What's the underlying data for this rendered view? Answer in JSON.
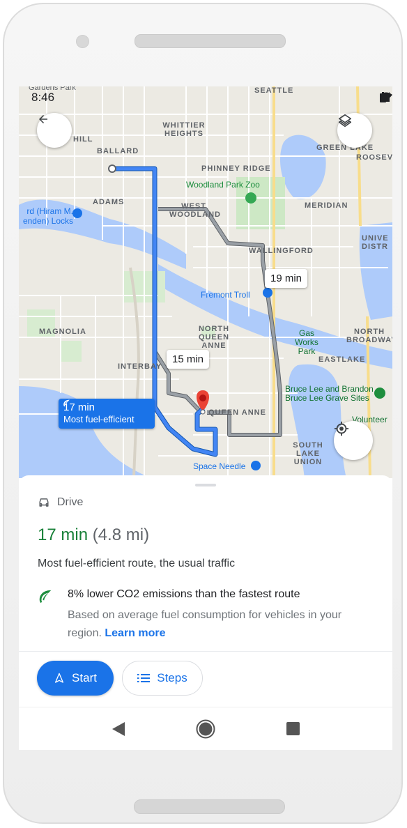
{
  "status": {
    "time": "8:46"
  },
  "map": {
    "neighborhoods": [
      "SEATTLE",
      "WHITTIER HEIGHTS",
      "HILL",
      "BALLARD",
      "PHINNEY RIDGE",
      "GREEN LAKE",
      "ROOSEV",
      "ADAMS",
      "WEST WOODLAND",
      "MERIDIAN",
      "WALLINGFORD",
      "UNIVE DISTR",
      "MAGNOLIA",
      "NORTH QUEEN ANNE",
      "NORTH BROADWAY",
      "EASTLAKE",
      "INTERBAY",
      "QUEEN ANNE",
      "SOUTH LAKE UNION",
      "Volunteer"
    ],
    "poi": {
      "gardens": "Gardens Park",
      "zoo": "Woodland Park Zoo",
      "locks": "rd (Hiram M. enden) Locks",
      "troll": "Fremont Troll",
      "gasworks": "Gas Works Park",
      "brucelee": "Bruce Lee and Brandon Bruce Lee Grave Sites",
      "needle": "Space Needle"
    },
    "callouts": {
      "alt1": "19 min",
      "alt2": "15 min",
      "selected_time": "17 min",
      "selected_label": "Most fuel-efficient"
    }
  },
  "sheet": {
    "mode": "Drive",
    "eta_time": "17 min",
    "eta_distance": "(4.8 mi)",
    "description": "Most fuel-efficient route, the usual traffic",
    "eco_main": "8% lower CO2 emissions than the fastest route",
    "eco_sub": "Based on average fuel consumption for vehicles in your region.",
    "learn_more": "Learn more",
    "start_label": "Start",
    "steps_label": "Steps"
  },
  "colors": {
    "route": "#1a73e8",
    "alt_route": "#9aa0a6",
    "eco_green": "#188038",
    "pin": "#ea4335"
  }
}
